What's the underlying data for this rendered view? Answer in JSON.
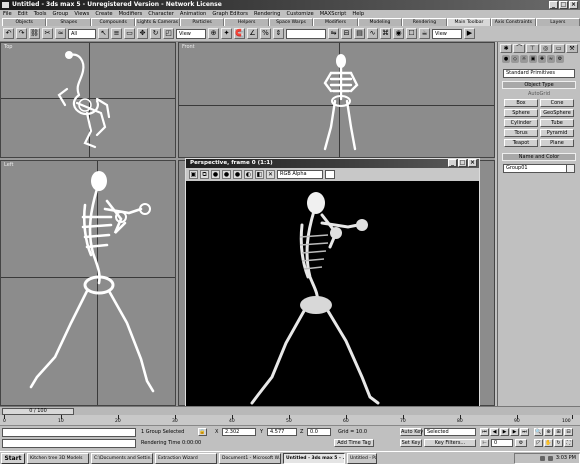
{
  "window": {
    "title": "Untitled - 3ds max 5 - Unregistered Version - Network License",
    "controls": [
      "_",
      "□",
      "×"
    ]
  },
  "menu": [
    "File",
    "Edit",
    "Tools",
    "Group",
    "Views",
    "Create",
    "Modifiers",
    "Character",
    "Animation",
    "Graph Editors",
    "Rendering",
    "Customize",
    "MAXScript",
    "Help"
  ],
  "tabs": [
    {
      "label": "Objects"
    },
    {
      "label": "Shapes"
    },
    {
      "label": "Compounds"
    },
    {
      "label": "Lights & Cameras"
    },
    {
      "label": "Particles"
    },
    {
      "label": "Helpers"
    },
    {
      "label": "Space Warps"
    },
    {
      "label": "Modifiers"
    },
    {
      "label": "Modeling"
    },
    {
      "label": "Rendering"
    },
    {
      "label": "Main Toolbar",
      "active": true
    },
    {
      "label": "Axis Constraints"
    },
    {
      "label": "Layers"
    }
  ],
  "toolbar": {
    "selection_filter": "All",
    "ref_coord": "View",
    "named_sel": "",
    "render_view": "View"
  },
  "viewports": {
    "top": "Top",
    "front": "Front",
    "left": "Left"
  },
  "render_window": {
    "title": "Perspective, frame 0 (1:1)",
    "channel": "RGB Alpha"
  },
  "command_panel": {
    "category": "Standard Primitives",
    "object_type_header": "Object Type",
    "autogrid": "AutoGrid",
    "object_buttons": [
      "Box",
      "Cone",
      "Sphere",
      "GeoSphere",
      "Cylinder",
      "Tube",
      "Torus",
      "Pyramid",
      "Teapot",
      "Plane"
    ],
    "name_color_header": "Name and Color",
    "name_value": "Group01"
  },
  "timeline": {
    "slider_label": "0 / 100",
    "ticks": [
      "0",
      "10",
      "20",
      "30",
      "40",
      "50",
      "60",
      "70",
      "80",
      "90",
      "100"
    ]
  },
  "status": {
    "selected": "1 Group Selected",
    "render_time": "Rendering Time 0:00:00",
    "x_label": "X",
    "x_value": "2.302",
    "y_label": "Y",
    "y_value": "4.577",
    "z_label": "Z",
    "z_value": "0.0",
    "grid": "Grid = 10.0",
    "add_time_tag": "Add Time Tag",
    "auto_key": "Auto Key",
    "set_key": "Set Key",
    "key_mode": "Selected",
    "key_filters": "Key Filters...",
    "frame": "0"
  },
  "taskbar": {
    "start": "Start",
    "items": [
      {
        "label": "Kitchen tree 3D Models"
      },
      {
        "label": "C:\\Documents and Settin..."
      },
      {
        "label": "Extraction Wizard"
      },
      {
        "label": "Document1 - Microsoft W..."
      },
      {
        "label": "Untitled - 3ds max 5 - ...",
        "active": true
      },
      {
        "label": "Untitled - Paint"
      }
    ],
    "clock": "3:03 PM"
  }
}
